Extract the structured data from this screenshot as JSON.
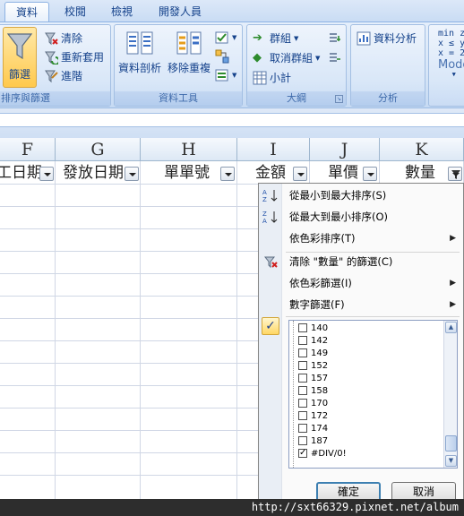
{
  "tabs": [
    "資料",
    "校閱",
    "檢視",
    "開發人員"
  ],
  "ribbon": {
    "sort_filter": {
      "filter_label": "篩選",
      "clear_label": "清除",
      "reapply_label": "重新套用",
      "advanced_label": "進階",
      "group_label": "排序與篩選"
    },
    "data_tools": {
      "text_to_columns_label": "資料剖析",
      "remove_duplicates_label": "移除重複",
      "group_label": "資料工具"
    },
    "outline": {
      "group_label_btn": "群組",
      "ungroup_label": "取消群組",
      "subtotal_label": "小計",
      "group_label": "大綱"
    },
    "analysis": {
      "data_analysis_label": "資料分析",
      "group_label": "分析"
    },
    "solver": {
      "line1": "min z",
      "line2": "x ≤ y",
      "line3": "x = 2",
      "mode_label": "Mode"
    }
  },
  "columns": [
    "F",
    "G",
    "H",
    "I",
    "J",
    "K"
  ],
  "header_row": [
    "工日期",
    "發放日期",
    "單單號",
    "金額",
    "單價",
    "數量"
  ],
  "filter_menu": {
    "sort_asc": "從最小到最大排序(S)",
    "sort_desc": "從最大到最小排序(O)",
    "sort_by_color": "依色彩排序(T)",
    "clear_filter": "清除 \"數量\" 的篩選(C)",
    "filter_by_color": "依色彩篩選(I)",
    "number_filters": "數字篩選(F)",
    "values": [
      {
        "label": "140",
        "checked": false
      },
      {
        "label": "142",
        "checked": false
      },
      {
        "label": "149",
        "checked": false
      },
      {
        "label": "152",
        "checked": false
      },
      {
        "label": "157",
        "checked": false
      },
      {
        "label": "158",
        "checked": false
      },
      {
        "label": "170",
        "checked": false
      },
      {
        "label": "172",
        "checked": false
      },
      {
        "label": "174",
        "checked": false
      },
      {
        "label": "187",
        "checked": false
      },
      {
        "label": "#DIV/0!",
        "checked": true
      }
    ],
    "ok_label": "確定",
    "cancel_label": "取消"
  },
  "watermark": "http://sxt66329.pixnet.net/album"
}
